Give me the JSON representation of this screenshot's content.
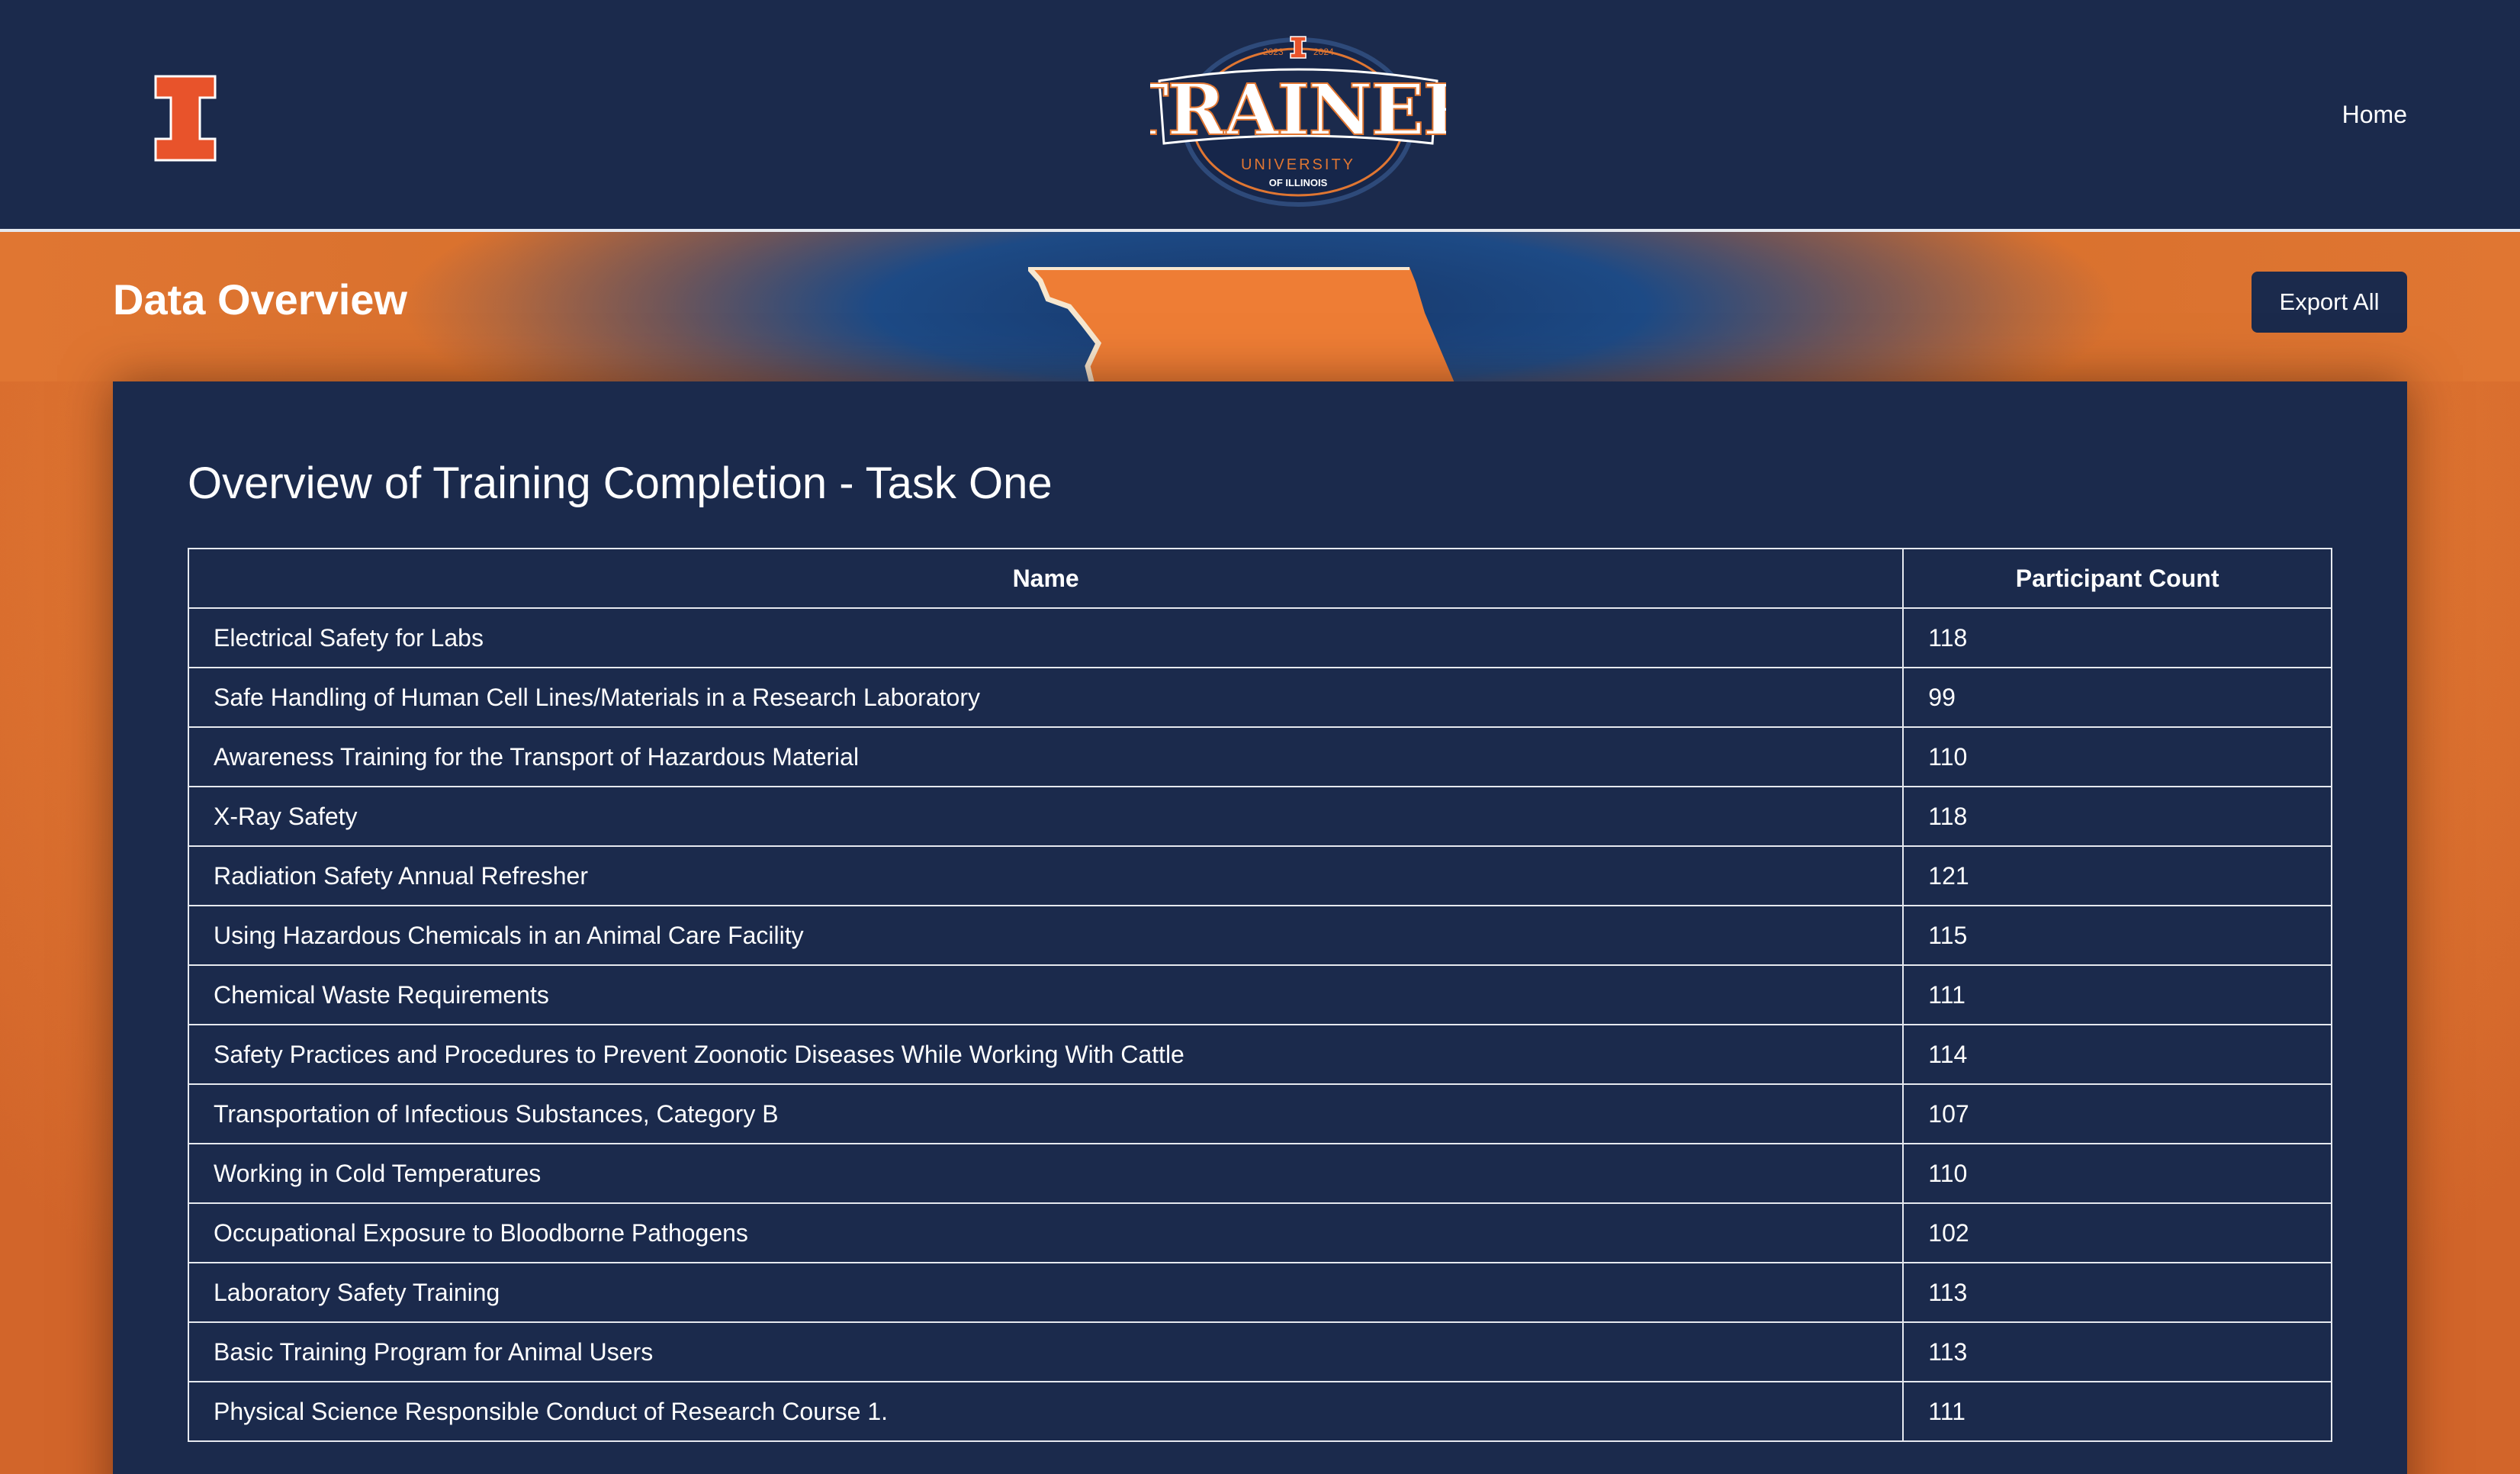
{
  "header": {
    "nav_home": "Home",
    "logo": {
      "years_left": "2023",
      "years_right": "2024",
      "word": "TRAINER",
      "sub1": "UNIVERSITY",
      "sub2": "OF ILLINOIS"
    }
  },
  "banner": {
    "title": "Data Overview",
    "export_label": "Export All"
  },
  "card": {
    "title": "Overview of Training Completion - Task One",
    "columns": [
      "Name",
      "Participant Count"
    ],
    "rows": [
      {
        "name": "Electrical Safety for Labs",
        "count": "118"
      },
      {
        "name": "Safe Handling of Human Cell Lines/Materials in a Research Laboratory",
        "count": "99"
      },
      {
        "name": "Awareness Training for the Transport of Hazardous Material",
        "count": "110"
      },
      {
        "name": "X-Ray Safety",
        "count": "118"
      },
      {
        "name": "Radiation Safety Annual Refresher",
        "count": "121"
      },
      {
        "name": "Using Hazardous Chemicals in an Animal Care Facility",
        "count": "115"
      },
      {
        "name": "Chemical Waste Requirements",
        "count": "111"
      },
      {
        "name": "Safety Practices and Procedures to Prevent Zoonotic Diseases While Working With Cattle",
        "count": "114"
      },
      {
        "name": "Transportation of Infectious Substances, Category B",
        "count": "107"
      },
      {
        "name": "Working in Cold Temperatures",
        "count": "110"
      },
      {
        "name": "Occupational Exposure to Bloodborne Pathogens",
        "count": "102"
      },
      {
        "name": "Laboratory Safety Training",
        "count": "113"
      },
      {
        "name": "Basic Training Program for Animal Users",
        "count": "113"
      },
      {
        "name": "Physical Science Responsible Conduct of Research Course 1.",
        "count": "111"
      }
    ]
  },
  "colors": {
    "navy": "#1b2a4c",
    "orange": "#e07632",
    "illini_orange": "#e8532b"
  }
}
